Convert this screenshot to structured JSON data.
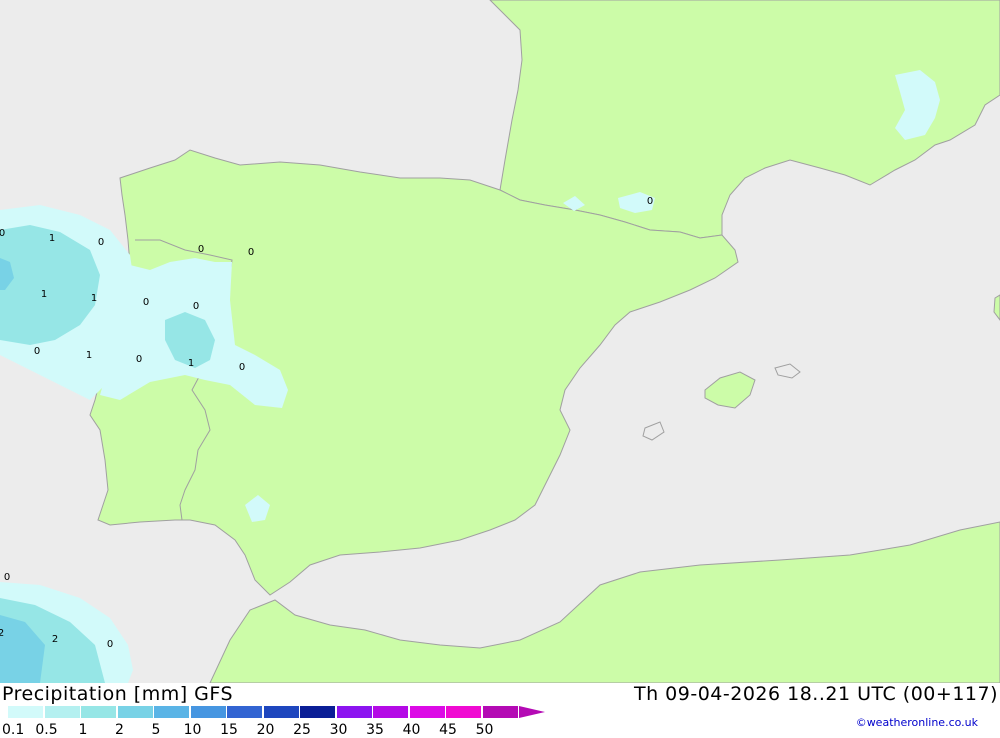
{
  "header": {
    "title": "Precipitation [mm] GFS",
    "datetime": "Th 09-04-2026 18..21 UTC (00+117)",
    "credit": "©weatheronline.co.uk"
  },
  "colors": {
    "sea": "#ececec",
    "land": "#ccfca8",
    "coast": "#a0a0a0"
  },
  "legend": [
    {
      "label": "0.1",
      "color": "#d2fafa"
    },
    {
      "label": "0.5",
      "color": "#b4f0f0"
    },
    {
      "label": "1",
      "color": "#96e6e6"
    },
    {
      "label": "2",
      "color": "#78d2e6"
    },
    {
      "label": "5",
      "color": "#5ab4e6"
    },
    {
      "label": "10",
      "color": "#4696e1"
    },
    {
      "label": "15",
      "color": "#3264d2"
    },
    {
      "label": "20",
      "color": "#1e46be"
    },
    {
      "label": "25",
      "color": "#0a1e96"
    },
    {
      "label": "30",
      "color": "#8c14f0"
    },
    {
      "label": "35",
      "color": "#b40ae6"
    },
    {
      "label": "40",
      "color": "#dc0ae6"
    },
    {
      "label": "45",
      "color": "#f00ad2"
    },
    {
      "label": "50",
      "color": "#b40ab4"
    }
  ],
  "map_labels": [
    "0",
    "1",
    "0",
    "0",
    "0",
    "1",
    "1",
    "0",
    "0",
    "0",
    "1",
    "0",
    "1",
    "0",
    "0",
    "0",
    "2",
    "0",
    "2"
  ]
}
